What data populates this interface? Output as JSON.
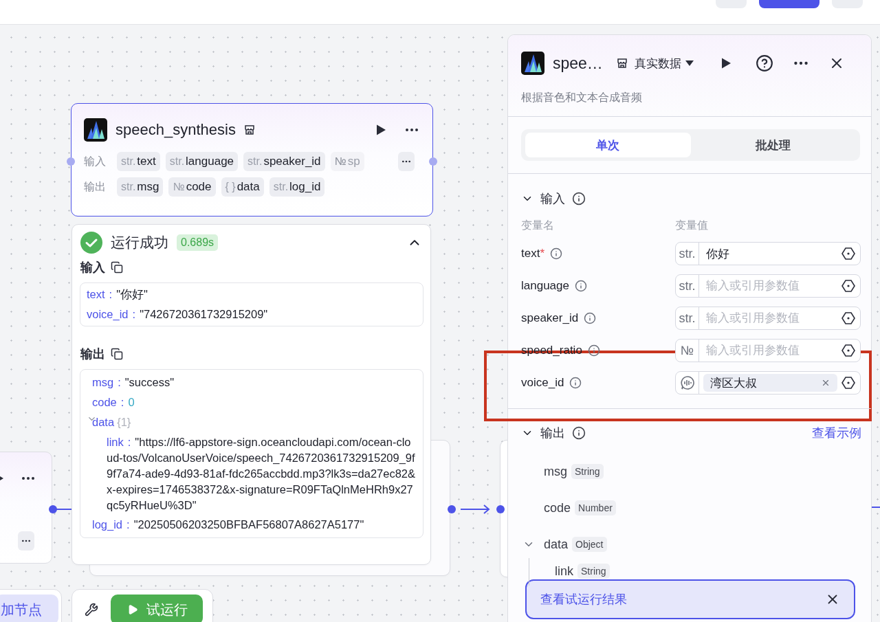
{
  "top_bar": {
    "buttons": [
      {
        "kind": "secondary"
      },
      {
        "kind": "primary"
      },
      {
        "kind": "secondary"
      }
    ]
  },
  "canvas": {
    "node": {
      "title": "speech_synthesis",
      "inputs_label": "输入",
      "inputs": [
        {
          "type": "str.",
          "name": "text",
          "faded": false
        },
        {
          "type": "str.",
          "name": "language",
          "faded": false
        },
        {
          "type": "str.",
          "name": "speaker_id",
          "faded": false
        },
        {
          "type": "№",
          "name": "sp",
          "faded": true
        }
      ],
      "outputs_label": "输出",
      "outputs": [
        {
          "type": "str.",
          "name": "msg",
          "faded": false
        },
        {
          "type": "№",
          "name": "code",
          "faded": false
        },
        {
          "type": "{ }",
          "name": "data",
          "faded": false
        },
        {
          "type": "str.",
          "name": "log_id",
          "faded": false
        }
      ]
    },
    "run_result": {
      "separator": ":",
      "status": "运行成功",
      "duration": "0.689s",
      "expanded": true,
      "input_title": "输入",
      "input_entries": [
        {
          "key": "text",
          "value": "\"你好\"",
          "kind": "string"
        },
        {
          "key": "voice_id",
          "value": "\"7426720361732915209\"",
          "kind": "string"
        }
      ],
      "output_title": "输出",
      "output_entries": [
        {
          "key": "msg",
          "value": "\"success\"",
          "kind": "string"
        },
        {
          "key": "code",
          "value": "0",
          "kind": "number"
        },
        {
          "key": "data",
          "summary": "{1}",
          "kind": "object",
          "expanded": true,
          "children": [
            {
              "key": "link",
              "value": "\"https://lf6-appstore-sign.oceancloudapi.com/ocean-cloud-tos/VolcanoUserVoice/speech_7426720361732915209_9f9f7a74-ade9-4d93-81af-fdc265accbdd.mp3?lk3s=da27ec82&x-expires=1746538372&x-signature=R09FTaQlnMeHRh9x27qc5yRHueU%3D\"",
              "kind": "string"
            }
          ]
        },
        {
          "key": "log_id",
          "value": "\"20250506203250BFBAF56807A8627A5177\"",
          "kind": "string"
        }
      ]
    }
  },
  "panel": {
    "title": "spee…",
    "data_mode": "真实数据",
    "description": "根据音色和文本合成音频",
    "tabs": [
      {
        "label": "单次",
        "selected": true
      },
      {
        "label": "批处理",
        "selected": false
      }
    ],
    "input_section": {
      "title": "输入",
      "expanded": true,
      "required_mark": "*",
      "name_header": "变量名",
      "value_header": "变量值",
      "params": [
        {
          "name": "text",
          "required": true,
          "kind": "typed",
          "type": "str.",
          "value": "你好"
        },
        {
          "name": "language",
          "required": false,
          "kind": "typed",
          "type": "str.",
          "placeholder": "输入或引用参数值"
        },
        {
          "name": "speaker_id",
          "required": false,
          "kind": "typed",
          "type": "str.",
          "placeholder": "输入或引用参数值"
        },
        {
          "name": "speed_ratio",
          "required": false,
          "kind": "typed",
          "type": "№",
          "placeholder": "输入或引用参数值"
        },
        {
          "name": "voice_id",
          "required": false,
          "kind": "voice",
          "value": "湾区大叔"
        }
      ]
    },
    "output_section": {
      "title": "输出",
      "expanded": true,
      "example_link": "查看示例",
      "fields": [
        {
          "name": "msg",
          "type": "String"
        },
        {
          "name": "code",
          "type": "Number"
        },
        {
          "name": "data",
          "type": "Object",
          "expanded": true,
          "children": [
            {
              "name": "link",
              "type": "String"
            }
          ]
        }
      ]
    },
    "toast": {
      "text": "查看试运行结果"
    }
  },
  "bottom_bar": {
    "add_node": "加节点",
    "test_run": "试运行"
  }
}
